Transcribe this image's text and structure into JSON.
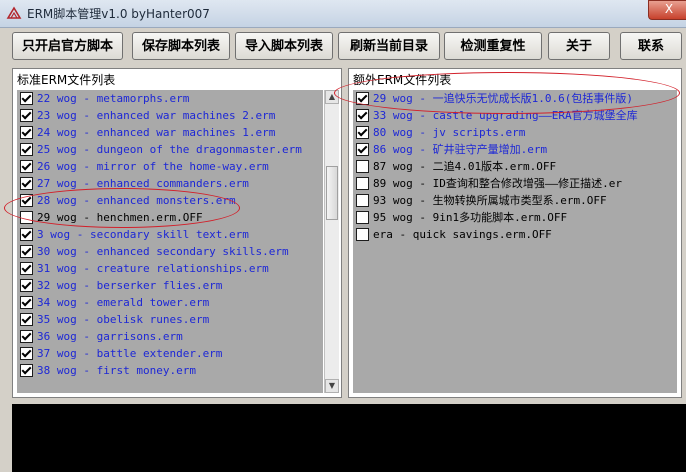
{
  "window": {
    "title": "ERM脚本管理v1.0  byHanter007",
    "close_glyph": "X"
  },
  "toolbar": {
    "buttons": [
      "只开启官方脚本",
      "保存脚本列表",
      "导入脚本列表",
      "刷新当前目录",
      "检测重复性",
      "关于",
      "联系"
    ]
  },
  "left_panel": {
    "title": "标准ERM文件列表",
    "items": [
      {
        "text": "22 wog - metamorphs.erm",
        "checked": true
      },
      {
        "text": "23 wog - enhanced war machines 2.erm",
        "checked": true
      },
      {
        "text": "24 wog - enhanced war machines 1.erm",
        "checked": true
      },
      {
        "text": "25 wog - dungeon of the dragonmaster.erm",
        "checked": true
      },
      {
        "text": "26 wog - mirror of the home-way.erm",
        "checked": true
      },
      {
        "text": "27 wog - enhanced commanders.erm",
        "checked": true
      },
      {
        "text": "28 wog - enhanced monsters.erm",
        "checked": true
      },
      {
        "text": "29 wog - henchmen.erm.OFF",
        "checked": false
      },
      {
        "text": "3 wog - secondary skill text.erm",
        "checked": true
      },
      {
        "text": "30 wog - enhanced secondary skills.erm",
        "checked": true
      },
      {
        "text": "31 wog - creature relationships.erm",
        "checked": true
      },
      {
        "text": "32 wog - berserker flies.erm",
        "checked": true
      },
      {
        "text": "34 wog - emerald tower.erm",
        "checked": true
      },
      {
        "text": "35 wog - obelisk runes.erm",
        "checked": true
      },
      {
        "text": "36 wog - garrisons.erm",
        "checked": true
      },
      {
        "text": "37 wog - battle extender.erm",
        "checked": true
      },
      {
        "text": "38 wog - first money.erm",
        "checked": true
      }
    ]
  },
  "right_panel": {
    "title": "额外ERM文件列表",
    "items": [
      {
        "text": "29 wog - 一追快乐无忧成长版1.0.6(包括事件版)",
        "checked": true
      },
      {
        "text": "33 wog - castle upgrading——ERA官方城堡全库",
        "checked": true
      },
      {
        "text": "80 wog - jv scripts.erm",
        "checked": true
      },
      {
        "text": "86 wog - 矿井驻守产量增加.erm",
        "checked": true
      },
      {
        "text": "87 wog - 二追4.01版本.erm.OFF",
        "checked": false
      },
      {
        "text": "89 wog - ID查询和整合修改增强——修正描述.er",
        "checked": false
      },
      {
        "text": "93 wog - 生物转换所属城市类型系.erm.OFF",
        "checked": false
      },
      {
        "text": "95 wog - 9in1多功能脚本.erm.OFF",
        "checked": false
      },
      {
        "text": "era - quick savings.erm.OFF",
        "checked": false
      }
    ]
  },
  "icons": {
    "app": "app-icon",
    "scroll_up": "arrow-up-icon",
    "scroll_down": "arrow-down-icon"
  }
}
